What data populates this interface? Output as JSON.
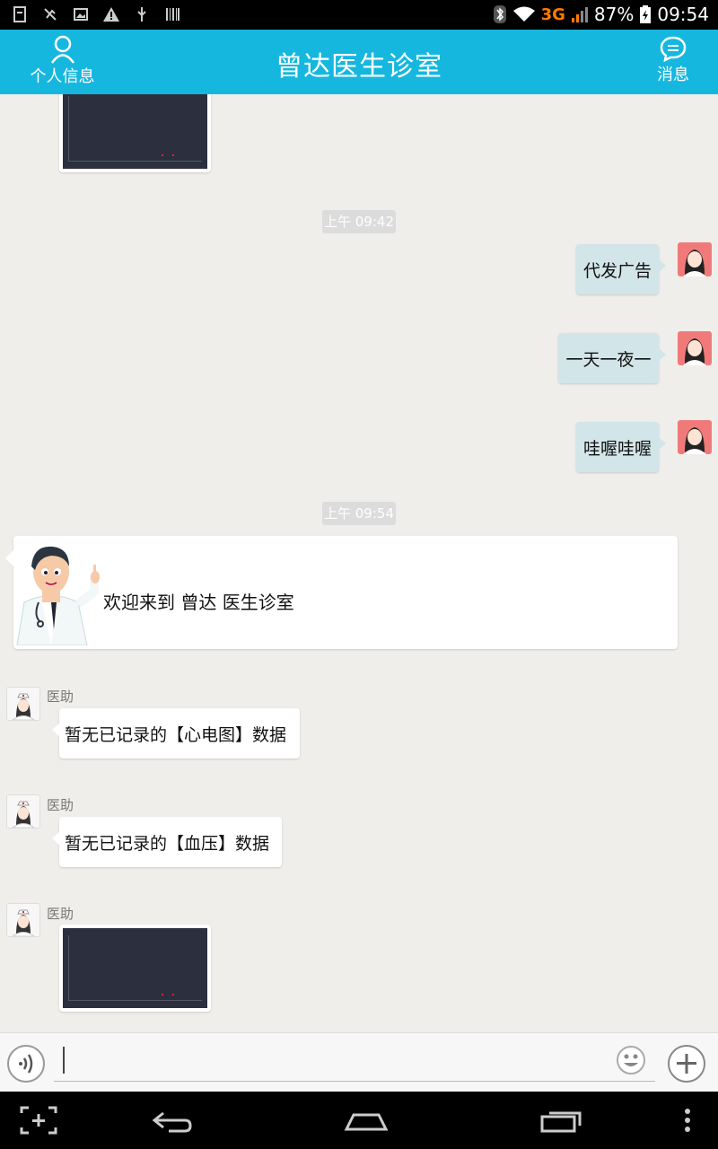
{
  "status_bar": {
    "battery": "87%",
    "time": "09:54",
    "network": "3G"
  },
  "header": {
    "title": "曾达医生诊室",
    "left_label": "个人信息",
    "right_label": "消息"
  },
  "chat": {
    "messages": [
      {
        "type": "time",
        "text": "上午 09:42"
      },
      {
        "type": "text",
        "from": "me",
        "text": "代发广告"
      },
      {
        "type": "text",
        "from": "me",
        "text": "一天一夜一"
      },
      {
        "type": "text",
        "from": "me",
        "text": "哇喔哇喔"
      },
      {
        "type": "time",
        "text": "上午 09:54"
      },
      {
        "type": "welcome",
        "text": "欢迎来到 曾达 医生诊室"
      },
      {
        "type": "text",
        "from": "assistant",
        "sender": "医助",
        "text": "暂无已记录的【心电图】数据"
      },
      {
        "type": "text",
        "from": "assistant",
        "sender": "医助",
        "text": "暂无已记录的【血压】数据"
      },
      {
        "type": "image",
        "from": "assistant",
        "sender": "医助"
      }
    ]
  },
  "input": {
    "value": "",
    "placeholder": ""
  },
  "colors": {
    "header": "#16b7df",
    "chat_bg": "#efeeea",
    "my_bubble": "#d2e5e8",
    "their_bubble": "#ffffff"
  }
}
